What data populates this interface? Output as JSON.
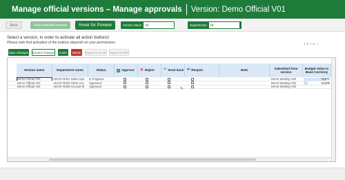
{
  "header": {
    "title": "Manage official versions – Manage approvals",
    "subtitle": "Version: Demo Official V01"
  },
  "topbar": {
    "back_label": "Back",
    "view_selected_label": "View selected version",
    "hover_preview_label": "Hover for Preview",
    "version_status_label": "Version status",
    "version_status_value": "All",
    "departments_label": "Departments",
    "departments_value": "All"
  },
  "instructions": {
    "line1": "Select a version, in order to activate all action buttons!",
    "line2": "Please note that activation of the buttons depends on your permissions"
  },
  "actions": {
    "save": "Save Changes",
    "discard": "Discard Changes",
    "insert": "Insert",
    "delete": "Delete",
    "export_xlsx": "Export to XLSX",
    "export_pdf": "Export to PDF"
  },
  "colors": {
    "brand_green": "#1e7b3a",
    "header_blue": "#dae8f7",
    "delete_red": "#c0392b",
    "check_green": "#2ea043",
    "reject_red": "#d62828"
  },
  "table": {
    "headers": {
      "version_name": "Version name",
      "department_name": "Department name",
      "status": "Status",
      "approve": "Approve",
      "reject": "Reject",
      "send_back": "Send back",
      "reopen": "Reopen",
      "note": "Note",
      "submitted_from": "Submitted from version",
      "budget_value": "Budget Value in Base Currency"
    },
    "rows": [
      {
        "version": "Demo Official V01",
        "department": "ADA07-E001 Sales Ops",
        "status": "In Progress",
        "submitted": "Demo Working V02",
        "budget": "73,971",
        "budget_fill": 0.85
      },
      {
        "version": "Demo Official V01",
        "department": "ADA07-E002 Client Acq",
        "status": "Approved",
        "submitted": "Demo Working V02",
        "budget": "13,000",
        "budget_fill": 0.15
      },
      {
        "version": "Demo Official V01",
        "department": "ADA07-E003 Account M",
        "status": "Approved",
        "submitted": "Demo Working V02",
        "budget": "",
        "budget_fill": 0
      }
    ]
  }
}
